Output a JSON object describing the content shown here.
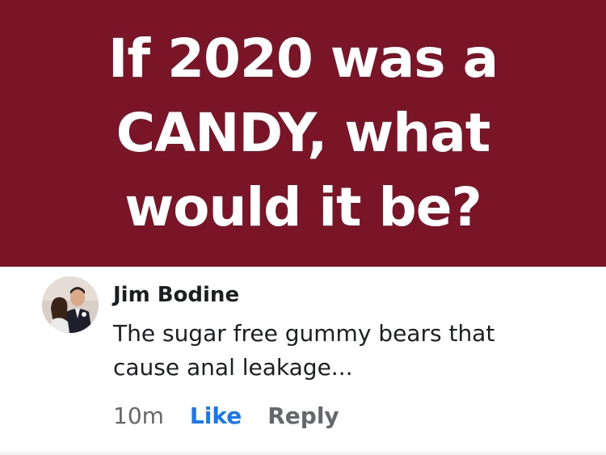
{
  "banner": {
    "lines": [
      "If 2020 was a",
      "CANDY, what",
      "would it be?"
    ],
    "background_color": "#7a1427",
    "text_color": "#ffffff"
  },
  "comment": {
    "author": "Jim Bodine",
    "text_lines": [
      "The sugar free gummy bears that",
      "cause anal leakage..."
    ],
    "timestamp": "10m",
    "like_label": "Like",
    "reply_label": "Reply",
    "avatar_icon": "profile-photo-icon",
    "link_color": "#1877f2"
  }
}
